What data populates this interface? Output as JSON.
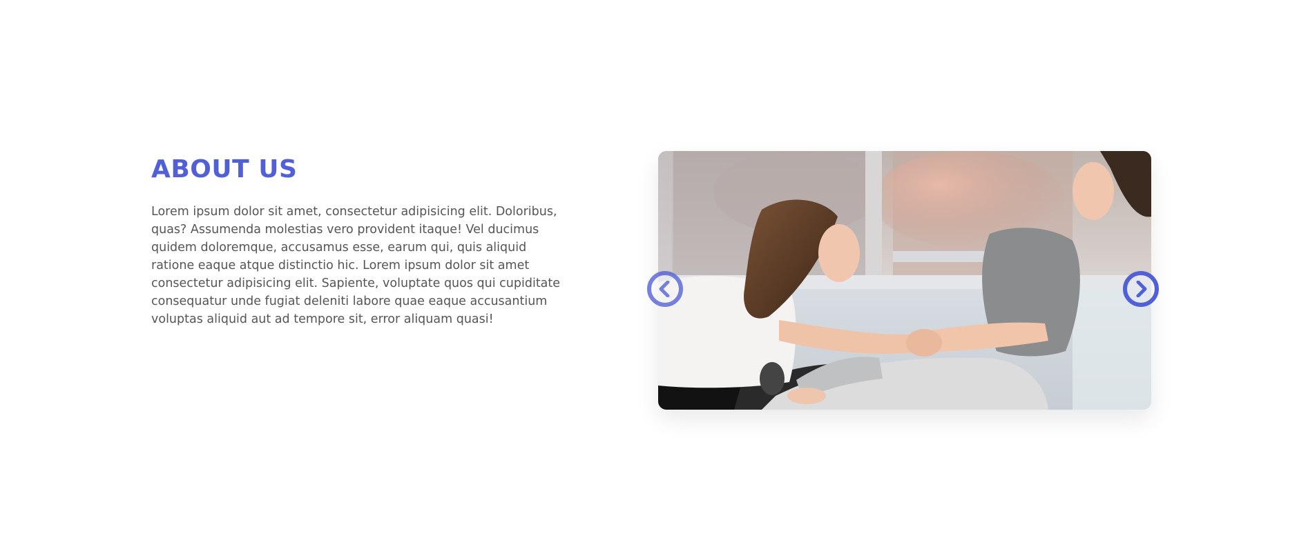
{
  "theme": {
    "accent": "#5160d6",
    "text": "#555555"
  },
  "about": {
    "title": "ABOUT US",
    "body": "Lorem ipsum dolor sit amet, consectetur adipisicing elit. Doloribus, quas? Assumenda molestias vero provident itaque! Vel ducimus quidem doloremque, accusamus esse, earum qui, quis aliquid ratione eaque atque distinctio hic. Lorem ipsum dolor sit amet consectetur adipisicing elit. Sapiente, voluptate quos qui cupiditate consequatur unde fugiat deleniti labore quae eaque accusantium voluptas aliquid aut ad tempore sit, error aliquam quasi!"
  },
  "carousel": {
    "slide_image": "photo-two-women-stretching",
    "prev_icon": "chevron-left-circle-icon",
    "next_icon": "chevron-right-circle-icon"
  }
}
